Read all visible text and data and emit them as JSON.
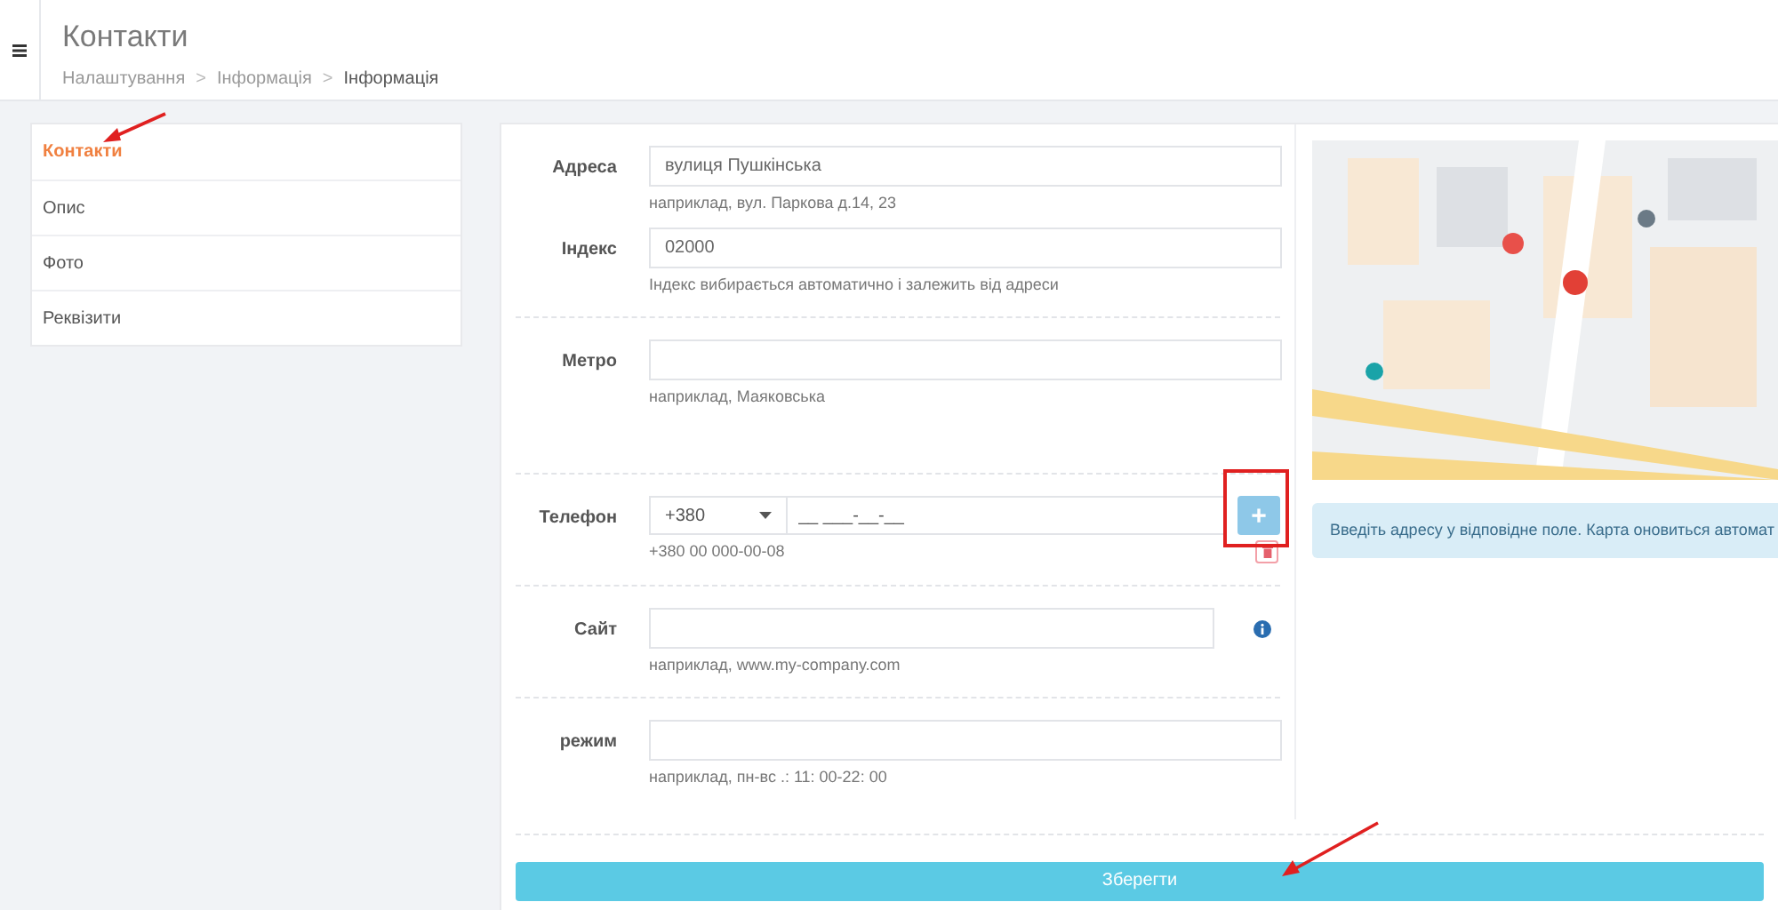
{
  "header": {
    "title": "Контакти",
    "breadcrumb": [
      {
        "label": "Налаштування",
        "current": false
      },
      {
        "label": "Інформація",
        "current": false
      },
      {
        "label": "Інформація",
        "current": true
      }
    ],
    "separator": ">"
  },
  "sidebar": {
    "items": [
      {
        "label": "Контакти",
        "selected": true
      },
      {
        "label": "Опис",
        "selected": false
      },
      {
        "label": "Фото",
        "selected": false
      },
      {
        "label": "Реквізити",
        "selected": false
      }
    ]
  },
  "form": {
    "sections": [
      {
        "fields": [
          {
            "kind": "text",
            "label": "Адреса",
            "value": "вулиця Пушкінська",
            "hint": "наприклад, вул. Паркова д.14, 23"
          },
          {
            "kind": "text",
            "label": "Індекс",
            "value": "02000",
            "hint": "Індекс вибирається автоматично і залежить від адреси"
          }
        ]
      },
      {
        "fields": [
          {
            "kind": "text",
            "label": "Метро",
            "hint": "наприклад, Маяковська"
          }
        ]
      },
      {
        "fields": [
          {
            "kind": "phone",
            "label": "Телефон",
            "code": "+380",
            "placeholder": "__ ___-__-__",
            "add_label": "+",
            "hint": "+380 00 000-00-08"
          }
        ]
      },
      {
        "fields": [
          {
            "kind": "info",
            "label": "Сайт",
            "hint": "наприклад, www.my-company.com"
          }
        ]
      },
      {
        "fields": [
          {
            "kind": "text",
            "label": "режим",
            "hint": "наприклад, пн-вс .: 11: 00-22: 00"
          }
        ]
      }
    ]
  },
  "map_alert": "Введіть адресу у відповідне поле. Карта оновиться автомат",
  "save_button": "Зберегти"
}
